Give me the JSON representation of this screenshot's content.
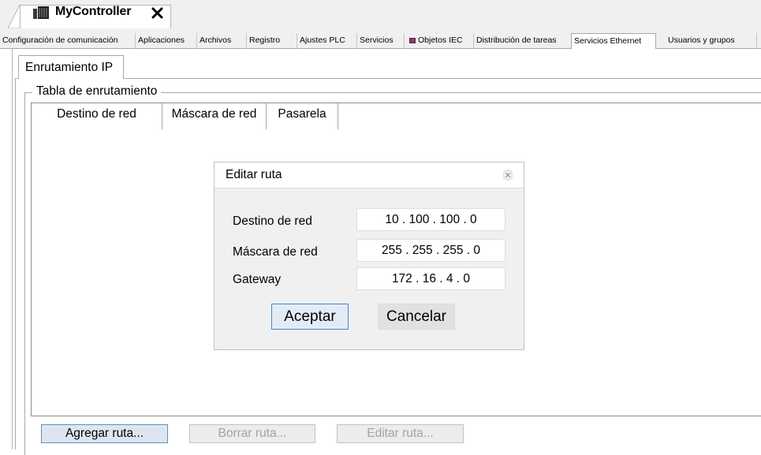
{
  "document_tab": {
    "title": "MyController",
    "close_icon": "close-icon",
    "icon": "controller-icon"
  },
  "tabs": [
    {
      "label": "Configuración de comunicación"
    },
    {
      "label": "Aplicaciones"
    },
    {
      "label": "Archivos"
    },
    {
      "label": "Registro"
    },
    {
      "label": "Ajustes PLC"
    },
    {
      "label": "Servicios"
    },
    {
      "label": "Objetos IEC",
      "icon": "iec-objects-icon"
    },
    {
      "label": "Distribución de tareas"
    },
    {
      "label": "Servicios Ethernet",
      "active": true
    },
    {
      "label": "Usuarios y grupos"
    }
  ],
  "subtab": {
    "label": "Enrutamiento IP"
  },
  "routing_table": {
    "legend": "Tabla de enrutamiento",
    "columns": [
      "Destino de red",
      "Máscara de red",
      "Pasarela"
    ]
  },
  "buttons": {
    "add": "Agregar ruta...",
    "delete": "Borrar ruta...",
    "edit": "Editar ruta..."
  },
  "dialog": {
    "title": "Editar ruta",
    "fields": [
      {
        "label": "Destino de red",
        "value": "10 . 100 . 100 . 0"
      },
      {
        "label": "Máscara de red",
        "value": "255 . 255 . 255 . 0"
      },
      {
        "label": "Gateway",
        "value": "172 . 16 . 4 . 0"
      }
    ],
    "ok": "Aceptar",
    "cancel": "Cancelar"
  },
  "colors": {
    "accent_border": "#3c88d6",
    "active_tab_bg": "#ffffff",
    "chrome_bg": "#f0f0f0"
  }
}
